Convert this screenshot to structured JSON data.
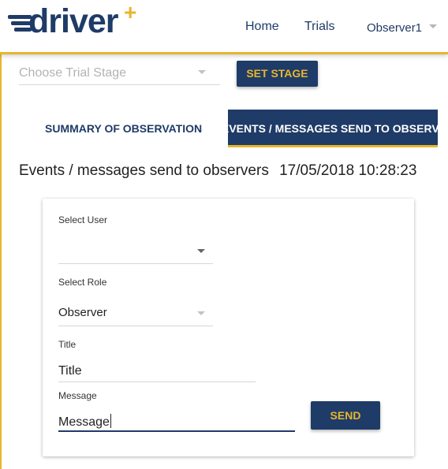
{
  "brand": {
    "name": "driver",
    "plus": "+"
  },
  "nav": {
    "home": "Home",
    "trials": "Trials",
    "user": "Observer1"
  },
  "stage": {
    "placeholder": "Choose Trial Stage",
    "button": "SET STAGE"
  },
  "tabs": [
    {
      "label": "SUMMARY OF OBSERVATIONS",
      "active": false
    },
    {
      "label": "EVENTS / MESSAGES SEND TO OBSERVERS",
      "active": true
    }
  ],
  "page": {
    "title": "Events / messages send to observers",
    "timestamp": "17/05/2018 10:28:23"
  },
  "form": {
    "user": {
      "label": "Select User",
      "value": ""
    },
    "role": {
      "label": "Select Role",
      "value": "Observer"
    },
    "title": {
      "label": "Title",
      "value": "Title"
    },
    "message": {
      "label": "Message",
      "value": "Message"
    },
    "send": "SEND"
  },
  "colors": {
    "primary": "#1f3b67",
    "accent": "#e8b62c"
  }
}
